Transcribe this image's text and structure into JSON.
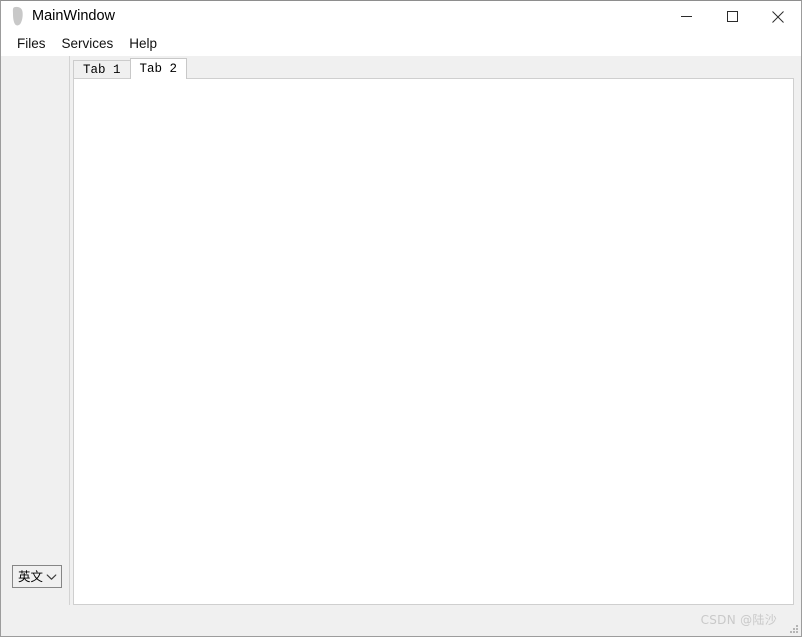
{
  "window": {
    "title": "MainWindow",
    "icon": "app-blob-icon",
    "controls": [
      {
        "name": "minimize-button",
        "glyph": "minimize-icon",
        "label": "Minimize"
      },
      {
        "name": "maximize-button",
        "glyph": "maximize-icon",
        "label": "Maximize"
      },
      {
        "name": "close-button",
        "glyph": "close-icon",
        "label": "Close"
      }
    ]
  },
  "menubar": {
    "items": [
      {
        "label": "Files"
      },
      {
        "label": "Services"
      },
      {
        "label": "Help"
      }
    ]
  },
  "tabs": {
    "items": [
      {
        "label": "Tab 1",
        "active": false
      },
      {
        "label": "Tab 2",
        "active": true
      }
    ],
    "active_index": 1,
    "content": ""
  },
  "language_combo": {
    "value": "英文",
    "arrow_icon": "chevron-down-icon"
  },
  "watermark": {
    "text": "CSDN @陆沙"
  },
  "colors": {
    "window_background": "#f0f0f0",
    "titlebar_background": "#ffffff",
    "tab_pane_background": "#ffffff",
    "border": "#cfcfcf",
    "watermark_text": "#c9c9c9",
    "text": "#000000"
  }
}
